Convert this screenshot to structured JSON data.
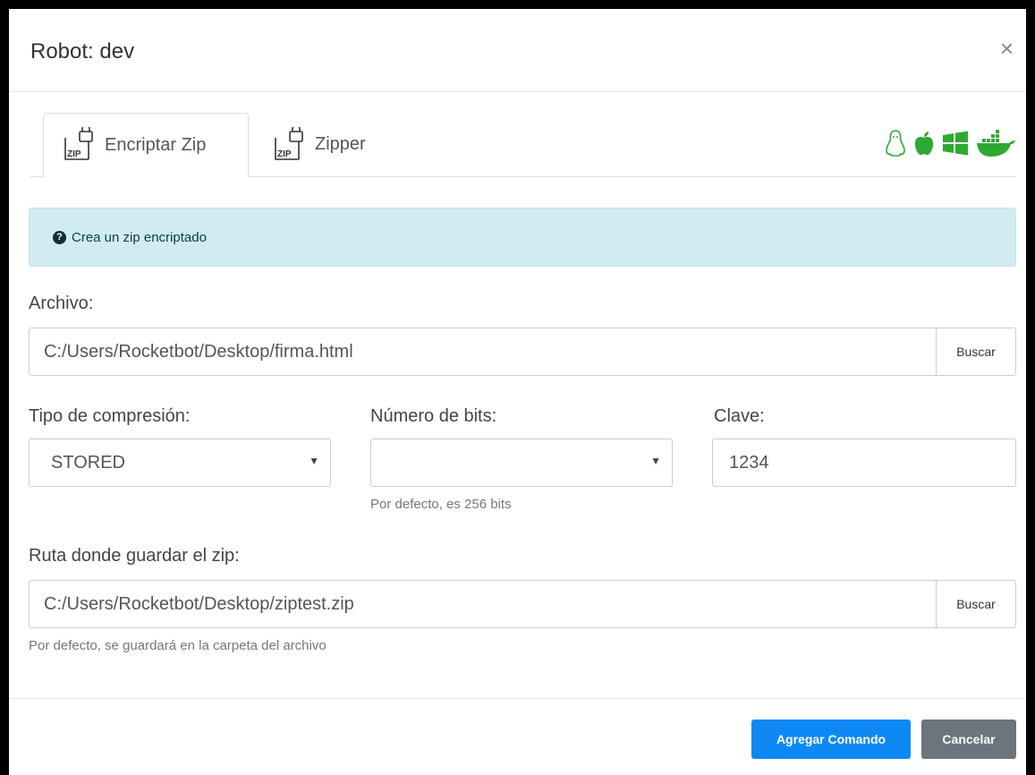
{
  "modal": {
    "title": "Robot: dev",
    "close_label": "×"
  },
  "tabs": [
    {
      "label": "Encriptar Zip",
      "icon": "zip-lock-icon",
      "active": true
    },
    {
      "label": "Zipper",
      "icon": "zip-lock-icon",
      "active": false
    }
  ],
  "zip_icon_text": "ZIP",
  "os_icons": [
    "linux-icon",
    "apple-icon",
    "windows-icon",
    "docker-icon"
  ],
  "colors": {
    "primary": "#0d88f5",
    "secondary": "#6c757d",
    "os_green": "#2ea832",
    "info_bg": "#d1ecf1"
  },
  "info": {
    "icon": "question-circle-icon",
    "text": "Crea un zip encriptado"
  },
  "form": {
    "archivo": {
      "label": "Archivo:",
      "value": "C:/Users/Rocketbot/Desktop/firma.html",
      "button": "Buscar"
    },
    "tipo_compresion": {
      "label": "Tipo de compresión:",
      "selected": "STORED"
    },
    "numero_bits": {
      "label": "Número de bits:",
      "selected": "",
      "help": "Por defecto, es 256 bits"
    },
    "clave": {
      "label": "Clave:",
      "value": "1234"
    },
    "ruta": {
      "label": "Ruta donde guardar el zip:",
      "value": "C:/Users/Rocketbot/Desktop/ziptest.zip",
      "button": "Buscar",
      "help": "Por defecto, se guardará en la carpeta del archivo"
    }
  },
  "footer": {
    "add_label": "Agregar Comando",
    "cancel_label": "Cancelar"
  }
}
